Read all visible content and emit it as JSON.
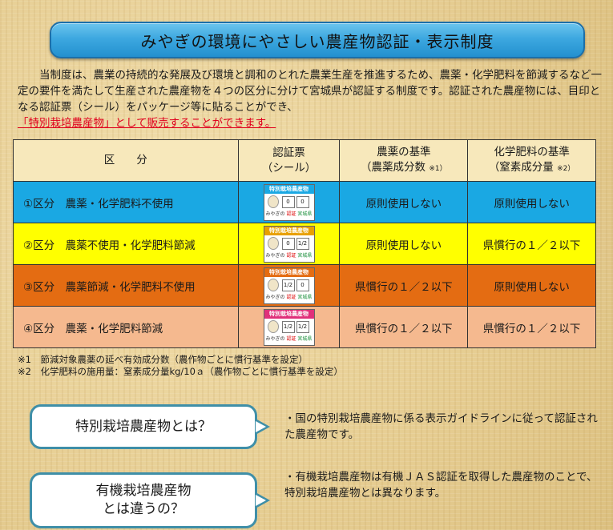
{
  "title": "みやぎの環境にやさしい農産物認証・表示制度",
  "intro": {
    "text": "当制度は、農業の持続的な発展及び環境と調和のとれた農業生産を推進するため、農薬・化学肥料を節減するなど一定の要件を満たして生産された農産物を４つの区分に分けて宮城県が認証する制度です。認証された農産物には、目印となる認証票（シール）をパッケージ等に貼ることができ、",
    "highlight": "「特別栽培農産物」として販売することができます。"
  },
  "table": {
    "headers": {
      "category": "区　　分",
      "seal_line1": "認証票",
      "seal_line2": "（シール）",
      "pesticide_line1": "農薬の基準",
      "pesticide_line2": "（農薬成分数",
      "pesticide_note": "※1）",
      "fertilizer_line1": "化学肥料の基準",
      "fertilizer_line2": "（窒素成分量",
      "fertilizer_note": "※2）"
    },
    "rows": [
      {
        "category": "①区分　農薬・化学肥料不使用",
        "pesticide": "原則使用しない",
        "fertilizer": "原則使用しない",
        "color": "#1aa8e3",
        "seal_color": "#1aa8e3",
        "seal_left": "0",
        "seal_right": "0"
      },
      {
        "category": "②区分　農薬不使用・化学肥料節減",
        "pesticide": "原則使用しない",
        "fertilizer": "県慣行の１／２以下",
        "color": "#ffff00",
        "seal_color": "#e8a000",
        "seal_left": "0",
        "seal_right": "1/2"
      },
      {
        "category": "③区分　農薬節減・化学肥料不使用",
        "pesticide": "県慣行の１／２以下",
        "fertilizer": "原則使用しない",
        "color": "#e46c12",
        "seal_color": "#e46c12",
        "seal_left": "1/2",
        "seal_right": "0"
      },
      {
        "category": "④区分　農薬・化学肥料節減",
        "pesticide": "県慣行の１／２以下",
        "fertilizer": "県慣行の１／２以下",
        "color": "#f5b98f",
        "seal_color": "#e0307a",
        "seal_left": "1/2",
        "seal_right": "1/2"
      }
    ],
    "seal": {
      "title": "特別栽培農産物",
      "foot_left": "みやぎの",
      "foot_mid": "認証",
      "foot_right": "宮城県"
    }
  },
  "notes": [
    "※1　節減対象農薬の延べ有効成分数（農作物ごとに慣行基準を設定）",
    "※2　化学肥料の施用量：窒素成分量kg/10ａ（農作物ごとに慣行基準を設定）"
  ],
  "qa": [
    {
      "question": "特別栽培農産物とは？",
      "answer": "・国の特別栽培農産物に係る表示ガイドラインに従って認証された農産物です。"
    },
    {
      "question_line1": "有機栽培農産物",
      "question_line2": "とは違うの？",
      "answer": "・有機栽培農産物は有機ＪＡＳ認証を取得した農産物のことで、特別栽培農産物とは異なります。"
    }
  ]
}
